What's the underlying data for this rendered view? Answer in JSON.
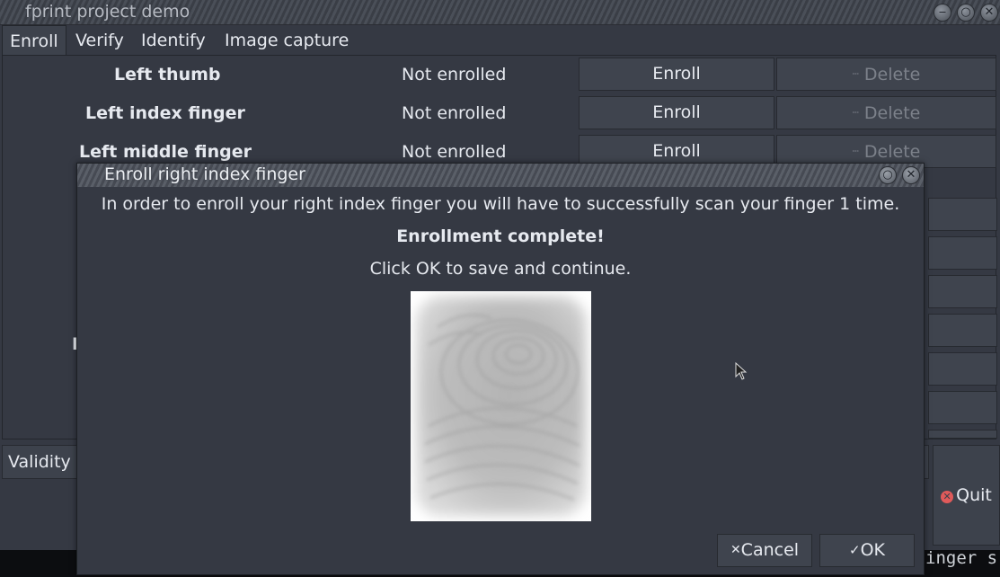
{
  "window": {
    "title": "fprint project demo"
  },
  "tabs": [
    {
      "label": "Enroll",
      "active": true
    },
    {
      "label": "Verify"
    },
    {
      "label": "Identify"
    },
    {
      "label": "Image capture"
    }
  ],
  "fingers": [
    {
      "label": "Left thumb",
      "status": "Not enrolled",
      "enroll_label": "Enroll",
      "delete_label": "Delete"
    },
    {
      "label": "Left index finger",
      "status": "Not enrolled",
      "enroll_label": "Enroll",
      "delete_label": "Delete"
    },
    {
      "label": "Left middle finger",
      "status": "Not enrolled",
      "enroll_label": "Enroll",
      "delete_label": "Delete"
    }
  ],
  "partial_label_letter": "I",
  "bottom": {
    "validity_label": "Validity",
    "quit_label": "Quit"
  },
  "terminal": {
    "text": "inger s"
  },
  "dialog": {
    "title": "Enroll right index finger",
    "instruction": "In order to enroll your right index finger you will have to successfully scan your finger 1 time.",
    "status": "Enrollment complete!",
    "hint": "Click OK to save and continue.",
    "cancel_label": "Cancel",
    "ok_label": "OK"
  },
  "icons": {
    "cancel": "x-icon",
    "ok": "checkmark-icon",
    "quit": "red-close-circle-icon",
    "delete": "dash-icon"
  },
  "colors": {
    "background": "#353943",
    "accent_quit": "#e05a5a"
  }
}
